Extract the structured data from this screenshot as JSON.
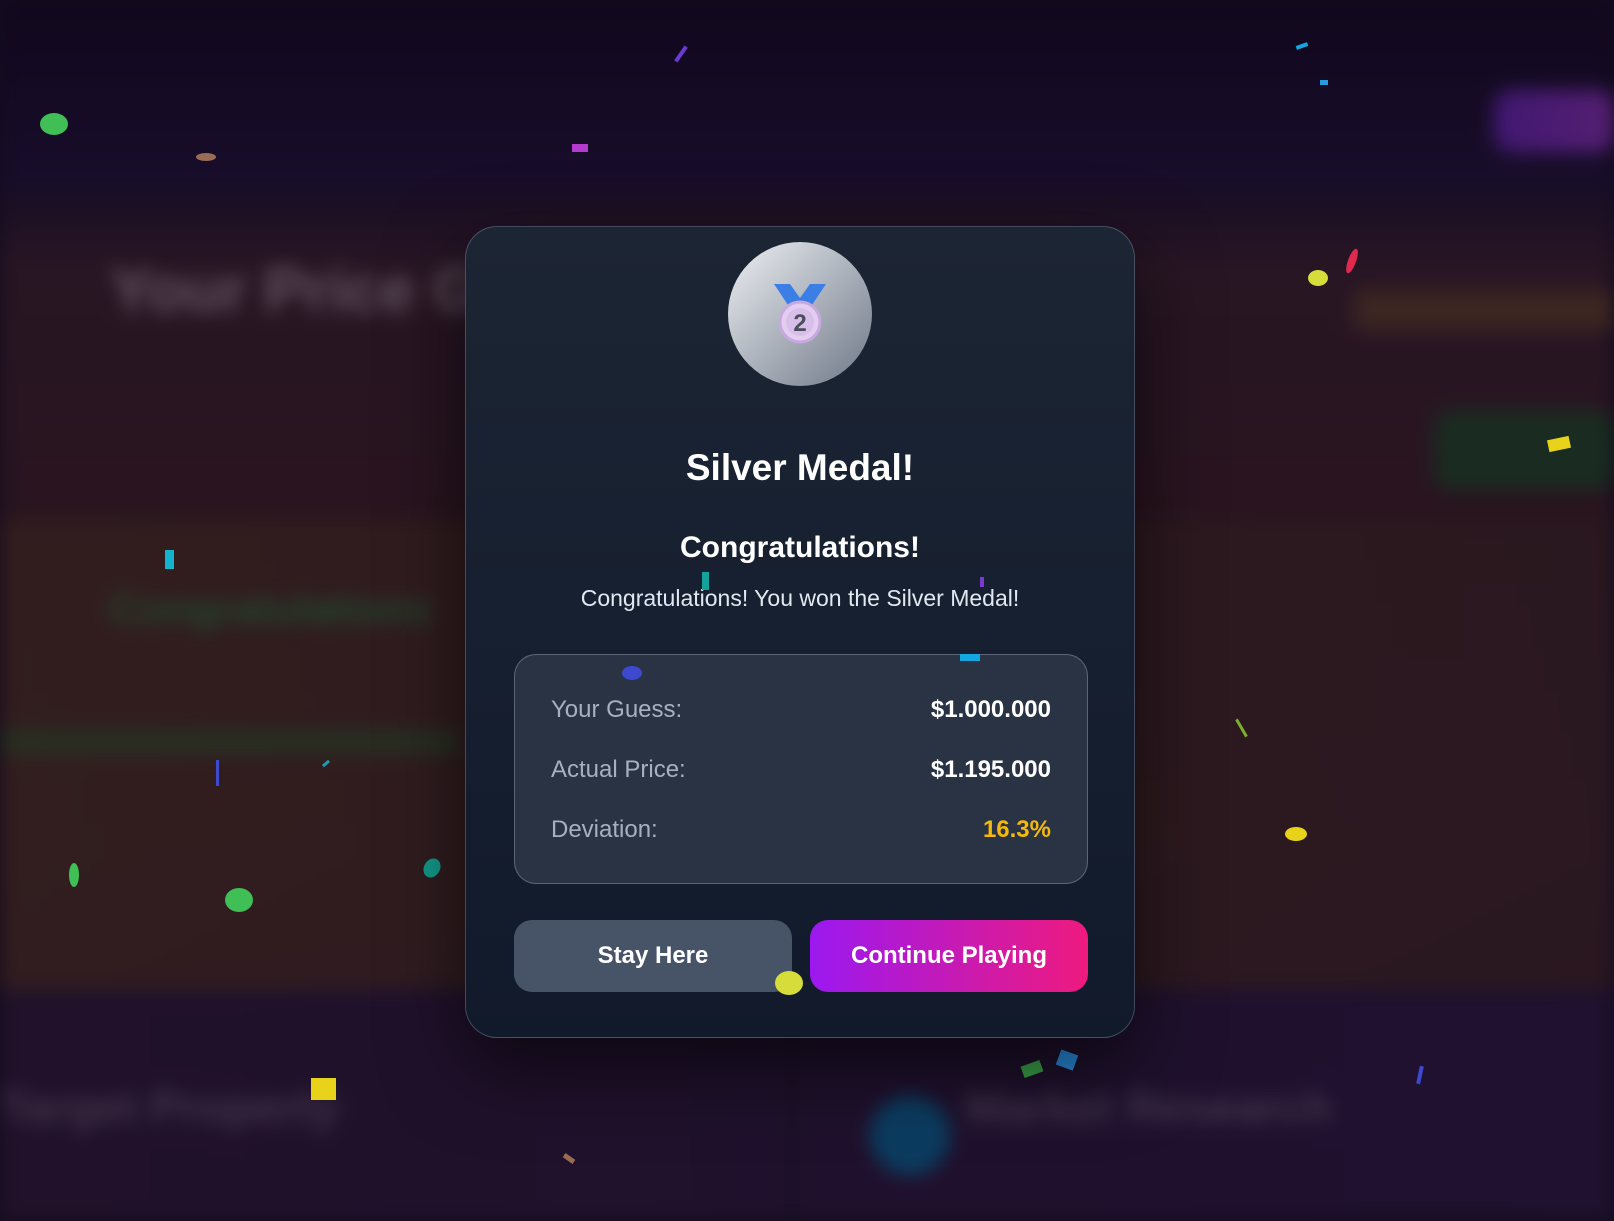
{
  "modal": {
    "medal_icon": "medal-icon",
    "medal_number": "2",
    "title": "Silver Medal!",
    "heading": "Congratulations!",
    "message": "Congratulations! You won the Silver Medal!",
    "stats": [
      {
        "label": "Your Guess:",
        "value": "$1.000.000"
      },
      {
        "label": "Actual Price:",
        "value": "$1.195.000"
      },
      {
        "label": "Deviation:",
        "value": "16.3%"
      }
    ],
    "buttons": {
      "stay": "Stay Here",
      "continue": "Continue Playing"
    }
  },
  "background": {
    "title": "Your Price Gu",
    "card_title": "Congratulations",
    "bottom_left": "Target Property",
    "bottom_right": "Market Research"
  },
  "colors": {
    "accent_start": "#9b19f0",
    "accent_end": "#ee1a7e",
    "deviation": "#f5b90b",
    "modal_bg": "#111a2b"
  }
}
